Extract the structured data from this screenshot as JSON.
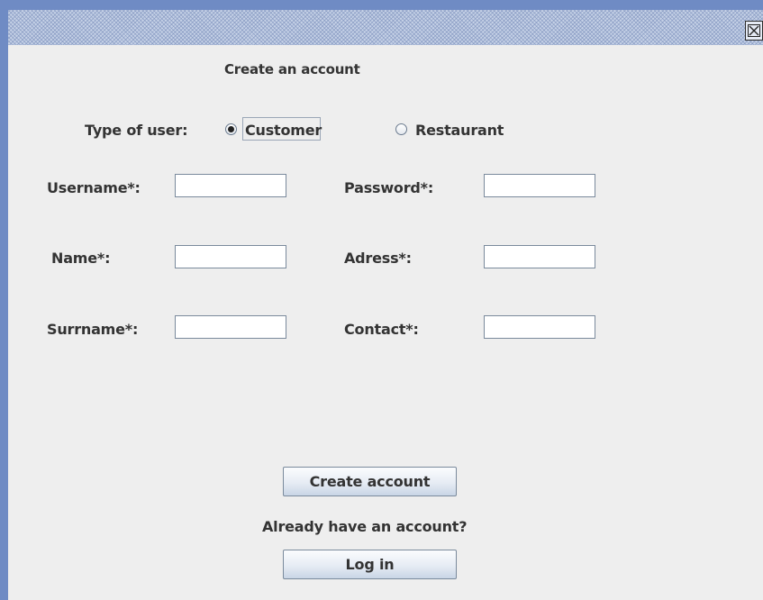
{
  "title_bar": {
    "close_glyph": "⊠"
  },
  "form": {
    "heading": "Create an account",
    "user_type": {
      "label": "Type of user:",
      "options": [
        "Customer",
        "Restaurant"
      ],
      "selected": "Customer"
    },
    "fields": {
      "username": {
        "label": "Username*:",
        "value": ""
      },
      "password": {
        "label": "Password*:",
        "value": ""
      },
      "name": {
        "label": "Name*:",
        "value": ""
      },
      "address": {
        "label": "Adress*:",
        "value": ""
      },
      "surname": {
        "label": "Surrname*:",
        "value": ""
      },
      "contact": {
        "label": "Contact*:",
        "value": ""
      }
    },
    "create_button": "Create account",
    "login_prompt": "Already have an account?",
    "login_button": "Log in"
  },
  "colors": {
    "window_border": "#6f8bc4",
    "background": "#eeeeee",
    "text": "#333333"
  }
}
